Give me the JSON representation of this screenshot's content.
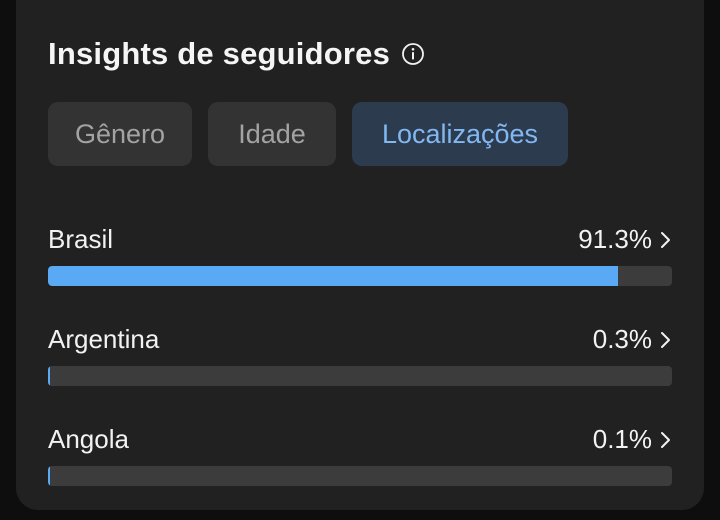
{
  "header": {
    "title": "Insights de seguidores",
    "info_icon": "info-circle-icon"
  },
  "tabs": [
    {
      "label": "Gênero",
      "active": false
    },
    {
      "label": "Idade",
      "active": false
    },
    {
      "label": "Localizações",
      "active": true
    }
  ],
  "locations": [
    {
      "name": "Brasil",
      "percent_label": "91.3%",
      "percent": 91.3
    },
    {
      "name": "Argentina",
      "percent_label": "0.3%",
      "percent": 0.3
    },
    {
      "name": "Angola",
      "percent_label": "0.1%",
      "percent": 0.1
    }
  ],
  "colors": {
    "accent": "#5aa9f5",
    "active_tab_bg": "#2c3b4e",
    "active_tab_text": "#82b8f2",
    "track": "#3c3c3d",
    "card_bg": "#212122"
  }
}
